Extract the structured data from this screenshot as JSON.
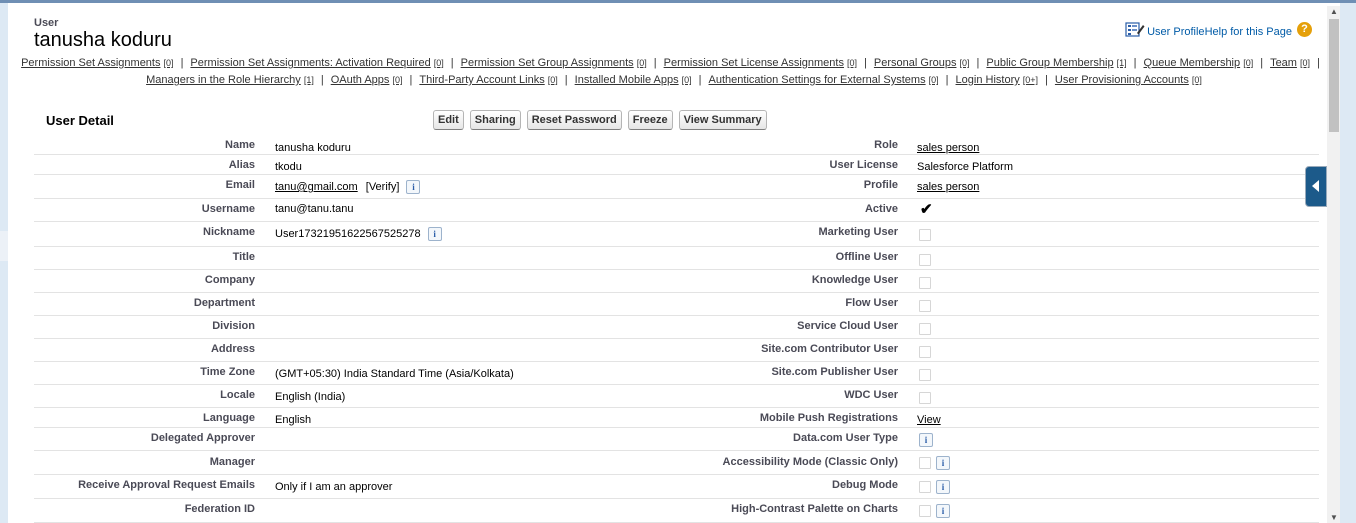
{
  "header": {
    "object_type": "User",
    "user_name": "tanusha koduru",
    "profile_link": "User Profile",
    "help_link": "Help for this Page"
  },
  "related_links_row1": [
    {
      "label": "Permission Set Assignments",
      "count": "[0]"
    },
    {
      "label": "Permission Set Assignments: Activation Required",
      "count": "[0]"
    },
    {
      "label": "Permission Set Group Assignments",
      "count": "[0]"
    },
    {
      "label": "Permission Set License Assignments",
      "count": "[0]"
    },
    {
      "label": "Personal Groups",
      "count": "[0]"
    },
    {
      "label": "Public Group Membership",
      "count": "[1]"
    },
    {
      "label": "Queue Membership",
      "count": "[0]"
    },
    {
      "label": "Team",
      "count": "[0]"
    }
  ],
  "related_links_row2": [
    {
      "label": "Managers in the Role Hierarchy",
      "count": "[1]"
    },
    {
      "label": "OAuth Apps",
      "count": "[0]"
    },
    {
      "label": "Third-Party Account Links",
      "count": "[0]"
    },
    {
      "label": "Installed Mobile Apps",
      "count": "[0]"
    },
    {
      "label": "Authentication Settings for External Systems",
      "count": "[0]"
    },
    {
      "label": "Login History",
      "count": "[0+]"
    },
    {
      "label": "User Provisioning Accounts",
      "count": "[0]"
    }
  ],
  "separator": "|",
  "detail": {
    "title": "User Detail",
    "buttons": [
      "Edit",
      "Sharing",
      "Reset Password",
      "Freeze",
      "View Summary"
    ],
    "verify_label": "[Verify]",
    "info_glyph": "i",
    "checkmark": "✔",
    "rows": [
      {
        "l": "Name",
        "v": "tanusha koduru",
        "r": "Role",
        "rv": "sales person"
      },
      {
        "l": "Alias",
        "v": "tkodu",
        "r": "User License",
        "rv": "Salesforce Platform"
      },
      {
        "l": "Email",
        "v": "tanu@gmail.com",
        "r": "Profile",
        "rv": "sales person"
      },
      {
        "l": "Username",
        "v": "tanu@tanu.tanu",
        "r": "Active",
        "rv": ""
      },
      {
        "l": "Nickname",
        "v": "User17321951622567525278",
        "r": "Marketing User",
        "rv": ""
      },
      {
        "l": "Title",
        "v": "",
        "r": "Offline User",
        "rv": ""
      },
      {
        "l": "Company",
        "v": "",
        "r": "Knowledge User",
        "rv": ""
      },
      {
        "l": "Department",
        "v": "",
        "r": "Flow User",
        "rv": ""
      },
      {
        "l": "Division",
        "v": "",
        "r": "Service Cloud User",
        "rv": ""
      },
      {
        "l": "Address",
        "v": "",
        "r": "Site.com Contributor User",
        "rv": ""
      },
      {
        "l": "Time Zone",
        "v": "(GMT+05:30) India Standard Time (Asia/Kolkata)",
        "r": "Site.com Publisher User",
        "rv": ""
      },
      {
        "l": "Locale",
        "v": "English (India)",
        "r": "WDC User",
        "rv": ""
      },
      {
        "l": "Language",
        "v": "English",
        "r": "Mobile Push Registrations",
        "rv": "View"
      },
      {
        "l": "Delegated Approver",
        "v": "",
        "r": "Data.com User Type",
        "rv": ""
      },
      {
        "l": "Manager",
        "v": "",
        "r": "Accessibility Mode (Classic Only)",
        "rv": ""
      },
      {
        "l": "Receive Approval Request Emails",
        "v": "Only if I am an approver",
        "r": "Debug Mode",
        "rv": ""
      },
      {
        "l": "Federation ID",
        "v": "",
        "r": "High-Contrast Palette on Charts",
        "rv": ""
      }
    ]
  }
}
